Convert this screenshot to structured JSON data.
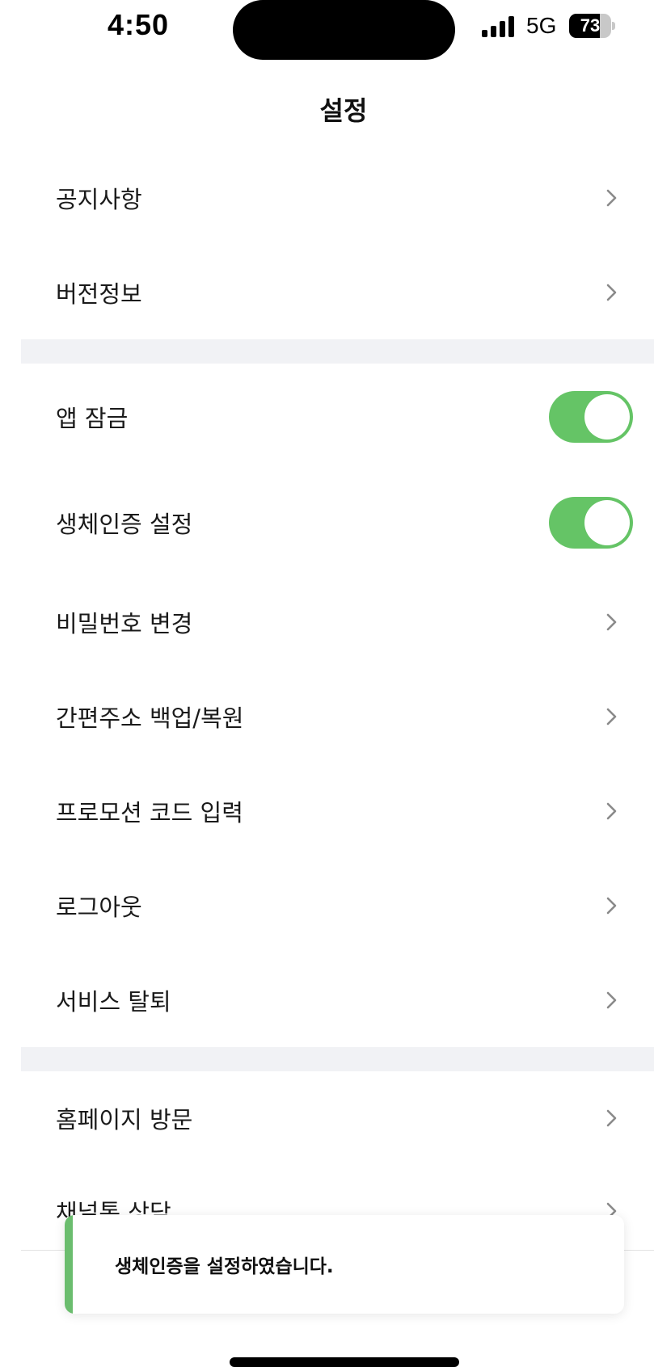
{
  "status_bar": {
    "time": "4:50",
    "network": "5G",
    "battery_percent": "73",
    "battery_level": 0.73
  },
  "header": {
    "title": "설정"
  },
  "section1": [
    {
      "label": "공지사항",
      "control": "chevron",
      "icon": "chevron-right-icon"
    },
    {
      "label": "버전정보",
      "control": "chevron",
      "icon": "chevron-right-icon"
    }
  ],
  "section2": [
    {
      "label": "앱 잠금",
      "control": "toggle",
      "on": true
    },
    {
      "label": "생체인증 설정",
      "control": "toggle",
      "on": true
    },
    {
      "label": "비밀번호 변경",
      "control": "chevron",
      "icon": "chevron-right-icon"
    },
    {
      "label": "간편주소 백업/복원",
      "control": "chevron",
      "icon": "chevron-right-icon"
    },
    {
      "label": "프로모션 코드 입력",
      "control": "chevron",
      "icon": "chevron-right-icon"
    },
    {
      "label": "로그아웃",
      "control": "chevron",
      "icon": "chevron-right-icon"
    },
    {
      "label": "서비스 탈퇴",
      "control": "chevron",
      "icon": "chevron-right-icon"
    }
  ],
  "section3": [
    {
      "label": "홈페이지 방문",
      "control": "chevron",
      "icon": "chevron-right-icon"
    },
    {
      "label": "채널톡 상담",
      "control": "chevron",
      "icon": "chevron-right-icon"
    }
  ],
  "toast": {
    "message": "생체인증을 설정하였습니다."
  },
  "colors": {
    "toggle_on": "#65c466",
    "toast_accent": "#6bbd6e",
    "divider": "#f1f2f5",
    "chevron": "#8a8a8a"
  }
}
